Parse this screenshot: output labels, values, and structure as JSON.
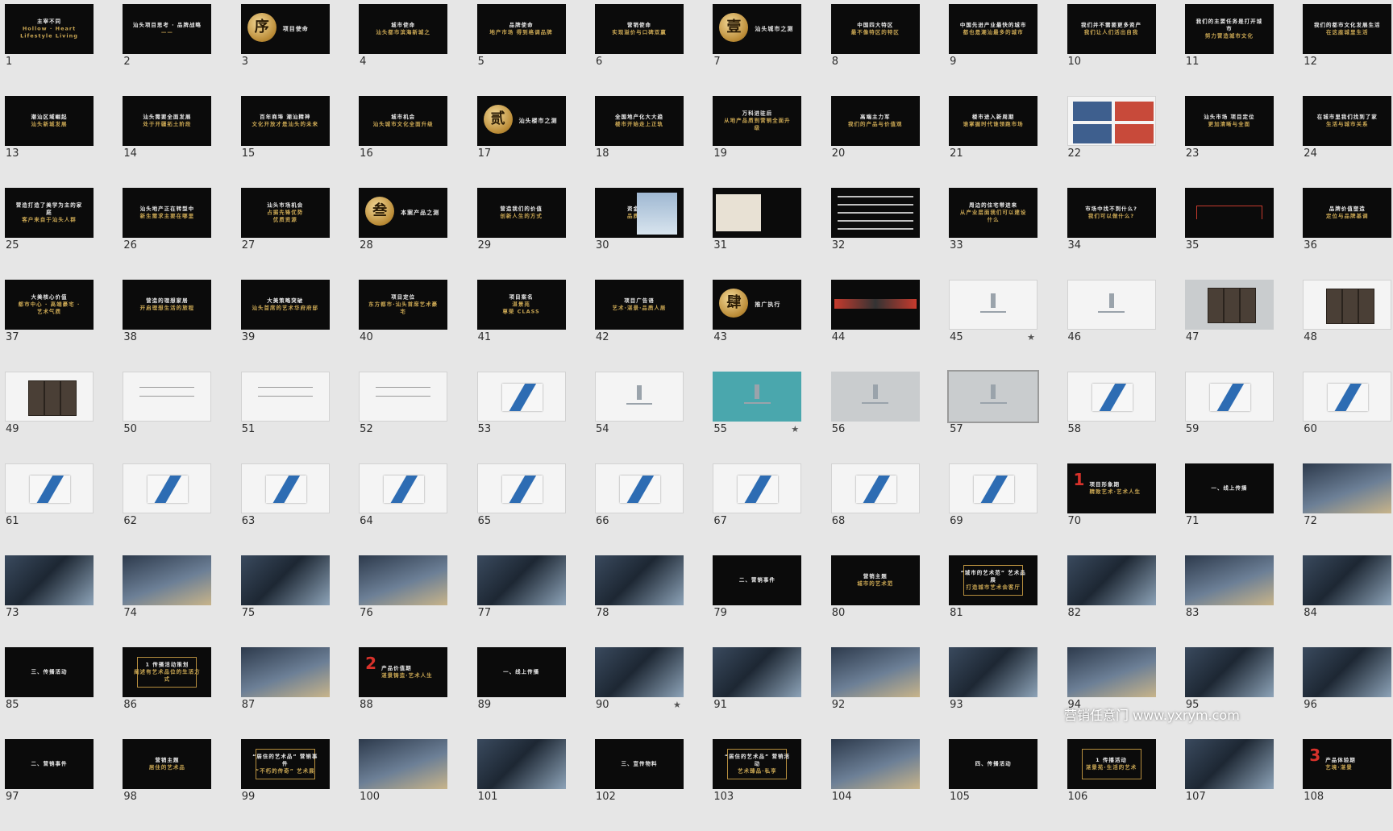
{
  "watermark": "营销任意门 www.yxrym.com",
  "slides": [
    {
      "num": "1",
      "style": "dark",
      "lines": [
        "主宰不同",
        "Hollow · Heart",
        "Lifestyle Living"
      ]
    },
    {
      "num": "2",
      "style": "dark",
      "lines": [
        "汕头项目思考  ·  品牌战略",
        "——"
      ]
    },
    {
      "num": "3",
      "style": "dark",
      "emblem": "序",
      "side": "项目使命"
    },
    {
      "num": "4",
      "style": "dark",
      "lines": [
        "城市使命",
        "汕头都市滨海新城之"
      ]
    },
    {
      "num": "5",
      "style": "dark",
      "lines": [
        "品牌使命",
        "地产市场 得到格调品牌"
      ]
    },
    {
      "num": "6",
      "style": "dark",
      "lines": [
        "营销使命",
        "实现溢价与口碑双赢"
      ]
    },
    {
      "num": "7",
      "style": "dark",
      "emblem": "壹",
      "side": "汕头城市之测"
    },
    {
      "num": "8",
      "style": "dark",
      "lines": [
        "中国四大特区",
        "最不像特区的特区"
      ]
    },
    {
      "num": "9",
      "style": "dark",
      "lines": [
        "中国先进产业最快的城市",
        "都也是潮汕最多的城市"
      ]
    },
    {
      "num": "10",
      "style": "dark",
      "lines": [
        "我们并不需要更多资产",
        "我们让人们活出自我"
      ]
    },
    {
      "num": "11",
      "style": "dark",
      "lines": [
        "我们的主要任务是打开城市",
        "努力营造城市文化"
      ]
    },
    {
      "num": "12",
      "style": "dark",
      "lines": [
        "我们的都市文化发展生活",
        "在这座城里生活"
      ]
    },
    {
      "num": "13",
      "style": "dark",
      "lines": [
        "潮汕区域崛起",
        "汕头新城发展"
      ]
    },
    {
      "num": "14",
      "style": "dark",
      "lines": [
        "汕头需要全面发展",
        "处于开疆拓土阶段"
      ]
    },
    {
      "num": "15",
      "style": "dark",
      "lines": [
        "百年商埠  潮汕精神",
        "文化开放才是汕头的未来"
      ]
    },
    {
      "num": "16",
      "style": "dark",
      "lines": [
        "城市机会",
        "汕头城市文化全面升级"
      ]
    },
    {
      "num": "17",
      "style": "dark",
      "emblem": "贰",
      "side": "汕头楼市之测"
    },
    {
      "num": "18",
      "style": "dark",
      "lines": [
        "全国地产化大大趋",
        "楼市开始走上正轨"
      ]
    },
    {
      "num": "19",
      "style": "dark",
      "lines": [
        "万科进驻后",
        "从地产品质到营销全面升级"
      ]
    },
    {
      "num": "20",
      "style": "dark",
      "lines": [
        "高端主力军",
        "我们的产品与价值观"
      ]
    },
    {
      "num": "21",
      "style": "dark",
      "lines": [
        "楼市进入新周期",
        "谁掌握时代谁领跑市场"
      ]
    },
    {
      "num": "22",
      "style": "light",
      "collage": true
    },
    {
      "num": "23",
      "style": "dark",
      "lines": [
        "汕头市场  项目定位",
        "更加清晰与全面"
      ]
    },
    {
      "num": "24",
      "style": "dark",
      "lines": [
        "在城市里我们找到了家",
        "生活与城市关系"
      ]
    },
    {
      "num": "25",
      "style": "dark",
      "lines": [
        "营造打造了美学为主的家庭",
        "客户来自于汕头人群"
      ]
    },
    {
      "num": "26",
      "style": "dark",
      "lines": [
        "汕头地产正在转型中",
        "新生需求主要在哪里"
      ]
    },
    {
      "num": "27",
      "style": "dark",
      "lines": [
        "汕头市场机会",
        "占据先锋优势",
        "优质资源"
      ]
    },
    {
      "num": "28",
      "style": "dark",
      "emblem": "叁",
      "side": "本案产品之测"
    },
    {
      "num": "29",
      "style": "dark",
      "lines": [
        "营造我们的价值",
        "创新人生的方式"
      ]
    },
    {
      "num": "30",
      "style": "dark",
      "building": true,
      "lines": [
        "资金信誉",
        "品质保障"
      ]
    },
    {
      "num": "31",
      "style": "dark",
      "map": true
    },
    {
      "num": "32",
      "style": "dark",
      "table": true
    },
    {
      "num": "33",
      "style": "dark",
      "lines": [
        "周边的住宅带进来",
        "从产业层面我们可以建设什么"
      ]
    },
    {
      "num": "34",
      "style": "dark",
      "lines": [
        "市场中找不到什么?",
        "我们可以做什么?"
      ]
    },
    {
      "num": "35",
      "style": "dark",
      "tree": true
    },
    {
      "num": "36",
      "style": "dark",
      "lines": [
        "品牌价值塑造",
        "定位与品牌基调"
      ]
    },
    {
      "num": "37",
      "style": "dark",
      "lines": [
        "大美核心价值",
        "都市中心 · 高端豪宅 · 艺术气质"
      ]
    },
    {
      "num": "38",
      "style": "dark",
      "lines": [
        "营造的理想家居",
        "开启理想生活的旅程"
      ]
    },
    {
      "num": "39",
      "style": "dark",
      "lines": [
        "大美策略突破",
        "汕头首席的艺术华府府邸"
      ]
    },
    {
      "num": "40",
      "style": "dark",
      "lines": [
        "项目定位",
        "东方都市·汕头首席艺术豪宅"
      ]
    },
    {
      "num": "41",
      "style": "dark",
      "lines": [
        "项目案名",
        "湛景苑",
        "尊荣 CLASS"
      ]
    },
    {
      "num": "42",
      "style": "dark",
      "lines": [
        "项目广告语",
        "艺术·湛景·品质人居"
      ]
    },
    {
      "num": "43",
      "style": "dark",
      "emblem": "肆",
      "side": "推广执行"
    },
    {
      "num": "44",
      "style": "dark",
      "strip": true
    },
    {
      "num": "45",
      "style": "light",
      "logo": true,
      "star": true
    },
    {
      "num": "46",
      "style": "light",
      "logo": true
    },
    {
      "num": "47",
      "style": "grey",
      "screen": true
    },
    {
      "num": "48",
      "style": "light",
      "screen": true
    },
    {
      "num": "49",
      "style": "light",
      "screen": true
    },
    {
      "num": "50",
      "style": "light",
      "bars": true
    },
    {
      "num": "51",
      "style": "light",
      "bars": true
    },
    {
      "num": "52",
      "style": "light",
      "bars": true
    },
    {
      "num": "53",
      "style": "light",
      "mock": true
    },
    {
      "num": "54",
      "style": "light",
      "logo": true
    },
    {
      "num": "55",
      "style": "teal",
      "logo": true,
      "star": true
    },
    {
      "num": "56",
      "style": "grey",
      "logo": true
    },
    {
      "num": "57",
      "style": "grey",
      "logo": true,
      "selected": true
    },
    {
      "num": "58",
      "style": "light",
      "mock": true
    },
    {
      "num": "59",
      "style": "light",
      "mock": true
    },
    {
      "num": "60",
      "style": "light",
      "mock": true
    },
    {
      "num": "61",
      "style": "light",
      "mock": true
    },
    {
      "num": "62",
      "style": "light",
      "mock": true
    },
    {
      "num": "63",
      "style": "light",
      "mock": true
    },
    {
      "num": "64",
      "style": "light",
      "mock": true
    },
    {
      "num": "65",
      "style": "light",
      "mock": true
    },
    {
      "num": "66",
      "style": "light",
      "mock": true
    },
    {
      "num": "67",
      "style": "light",
      "mock": true
    },
    {
      "num": "68",
      "style": "light",
      "mock": true
    },
    {
      "num": "69",
      "style": "light",
      "mock": true
    },
    {
      "num": "70",
      "style": "dark",
      "bignum": "1",
      "lines": [
        "项目形象期",
        "精致艺术·艺术人生"
      ]
    },
    {
      "num": "71",
      "style": "dark",
      "lines": [
        "一、线上传播"
      ]
    },
    {
      "num": "72",
      "style": "photo2"
    },
    {
      "num": "73",
      "style": "photo"
    },
    {
      "num": "74",
      "style": "photo2"
    },
    {
      "num": "75",
      "style": "photo"
    },
    {
      "num": "76",
      "style": "photo2"
    },
    {
      "num": "77",
      "style": "photo"
    },
    {
      "num": "78",
      "style": "photo"
    },
    {
      "num": "79",
      "style": "dark",
      "lines": [
        "二、营销事件"
      ]
    },
    {
      "num": "80",
      "style": "dark",
      "lines": [
        "营销主题",
        "城市的艺术范"
      ]
    },
    {
      "num": "81",
      "style": "dark",
      "frame": true,
      "lines": [
        "“城市的艺术范”  艺术品展",
        "打造城市艺术会客厅"
      ]
    },
    {
      "num": "82",
      "style": "photo"
    },
    {
      "num": "83",
      "style": "photo2"
    },
    {
      "num": "84",
      "style": "photo"
    },
    {
      "num": "85",
      "style": "dark",
      "lines": [
        "三、传播活动"
      ]
    },
    {
      "num": "86",
      "style": "dark",
      "frame": true,
      "lines": [
        "1 传播活动策划",
        "阐述有艺术品位的生活方式"
      ]
    },
    {
      "num": "87",
      "style": "photo2"
    },
    {
      "num": "88",
      "style": "dark",
      "bignum": "2",
      "lines": [
        "产品价值期",
        "湛景铸造·艺术人生"
      ]
    },
    {
      "num": "89",
      "style": "dark",
      "lines": [
        "一、线上传播"
      ]
    },
    {
      "num": "90",
      "style": "photo",
      "star": true
    },
    {
      "num": "91",
      "style": "photo"
    },
    {
      "num": "92",
      "style": "photo2"
    },
    {
      "num": "93",
      "style": "photo"
    },
    {
      "num": "94",
      "style": "photo2"
    },
    {
      "num": "95",
      "style": "photo"
    },
    {
      "num": "96",
      "style": "photo"
    },
    {
      "num": "97",
      "style": "dark",
      "lines": [
        "二、营销事件"
      ]
    },
    {
      "num": "98",
      "style": "dark",
      "lines": [
        "营销主题",
        "居住的艺术品"
      ]
    },
    {
      "num": "99",
      "style": "dark",
      "frame": true,
      "lines": [
        "“居住的艺术品”  营销事件",
        "“不朽的传奇”  艺术展"
      ]
    },
    {
      "num": "100",
      "style": "photo2"
    },
    {
      "num": "101",
      "style": "photo"
    },
    {
      "num": "102",
      "style": "dark",
      "lines": [
        "三、宣传物料"
      ]
    },
    {
      "num": "103",
      "style": "dark",
      "frame": true,
      "lines": [
        "“居住的艺术品”  营销活动",
        "艺术臻品·私享"
      ]
    },
    {
      "num": "104",
      "style": "photo2"
    },
    {
      "num": "105",
      "style": "dark",
      "lines": [
        "四、传播活动"
      ]
    },
    {
      "num": "106",
      "style": "dark",
      "frame": true,
      "lines": [
        "1 传播活动",
        "湛景苑·生活的艺术"
      ]
    },
    {
      "num": "107",
      "style": "photo"
    },
    {
      "num": "108",
      "style": "dark",
      "bignum": "3",
      "lines": [
        "产品体验期",
        "艺境·湛景"
      ]
    }
  ]
}
